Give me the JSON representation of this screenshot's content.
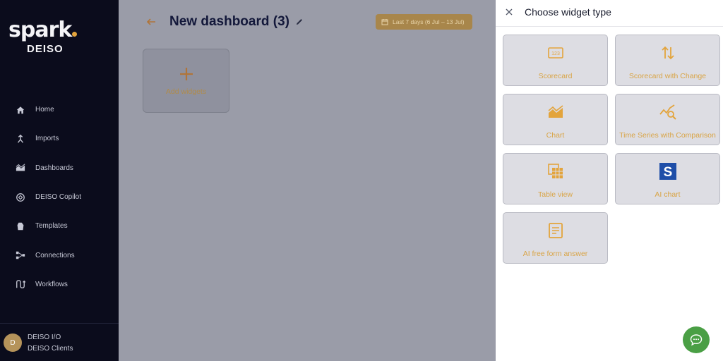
{
  "brand": {
    "name": "spark",
    "sub": "DEISO",
    "accent": "#e3a43c"
  },
  "sidebar": {
    "items": [
      {
        "label": "Home",
        "icon": "home-icon"
      },
      {
        "label": "Imports",
        "icon": "imports-icon"
      },
      {
        "label": "Dashboards",
        "icon": "dashboards-icon"
      },
      {
        "label": "DEISO Copilot",
        "icon": "copilot-icon"
      },
      {
        "label": "Templates",
        "icon": "templates-icon"
      },
      {
        "label": "Connections",
        "icon": "connections-icon"
      },
      {
        "label": "Workflows",
        "icon": "workflows-icon"
      }
    ],
    "user": {
      "initial": "D",
      "name": "DEISO I/O",
      "org": "DEISO Clients"
    }
  },
  "header": {
    "title": "New dashboard (3)",
    "date_range": "Last 7 days (6 Jul – 13 Jul)"
  },
  "main": {
    "add_widgets_label": "Add widgets"
  },
  "panel": {
    "title": "Choose widget type",
    "widgets": [
      {
        "label": "Scorecard",
        "icon": "scorecard-icon"
      },
      {
        "label": "Scorecard with Change",
        "icon": "change-arrows-icon"
      },
      {
        "label": "Chart",
        "icon": "area-chart-icon"
      },
      {
        "label": "Time Series with Comparison",
        "icon": "time-series-search-icon"
      },
      {
        "label": "Table view",
        "icon": "table-icon"
      },
      {
        "label": "AI chart",
        "icon": "s-logo-icon"
      },
      {
        "label": "AI free form answer",
        "icon": "document-icon"
      }
    ]
  },
  "colors": {
    "accent": "#e3a43c",
    "sidebar_bg": "#0b0c1c",
    "chat_button": "#4a9f45"
  }
}
